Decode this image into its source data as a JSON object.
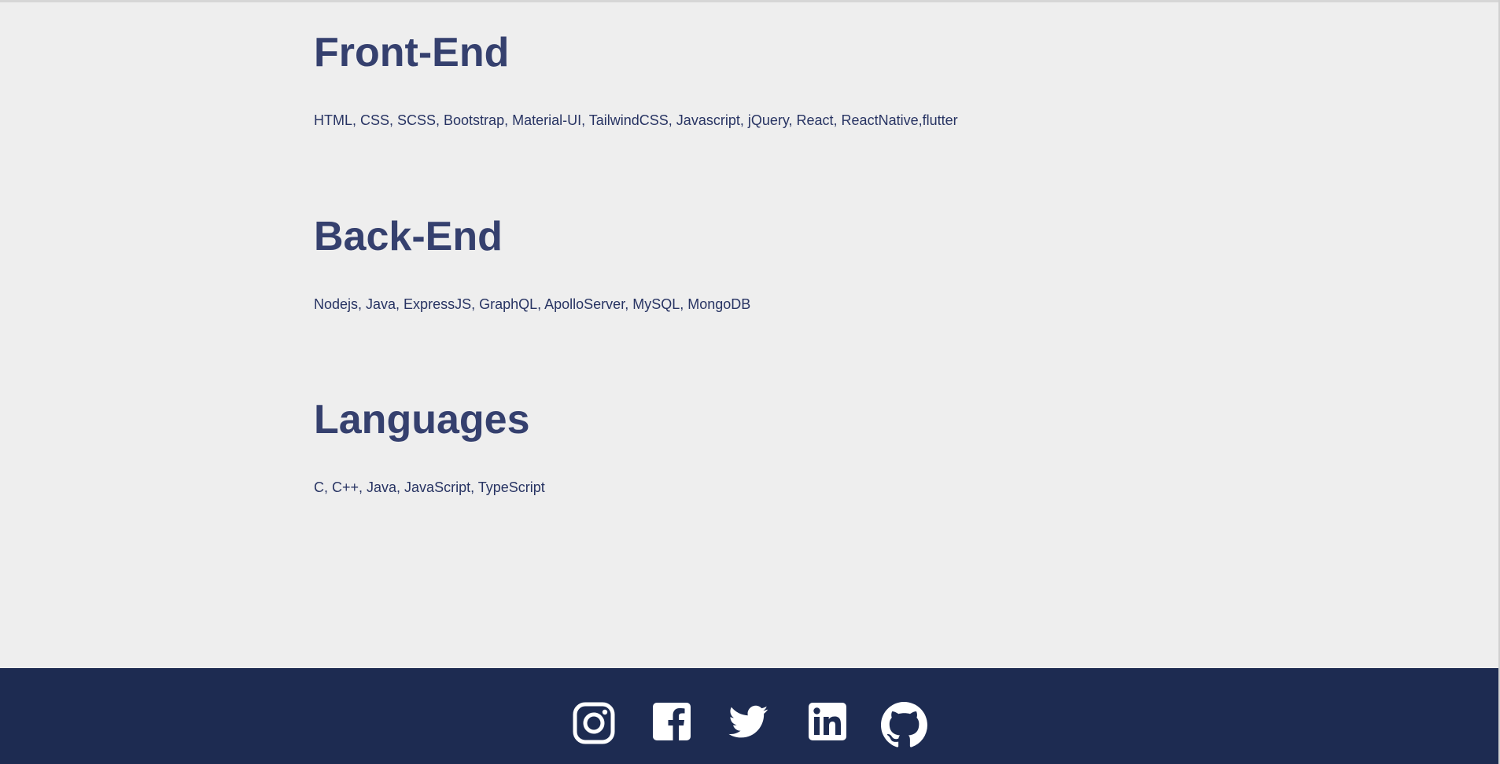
{
  "sections": [
    {
      "title": "Front-End",
      "text": "HTML, CSS, SCSS, Bootstrap, Material-UI, TailwindCSS, Javascript, jQuery, React, ReactNative,flutter"
    },
    {
      "title": "Back-End",
      "text": "Nodejs, Java, ExpressJS, GraphQL, ApolloServer, MySQL, MongoDB"
    },
    {
      "title": "Languages",
      "text": "C, C++, Java, JavaScript, TypeScript"
    }
  ],
  "footer": {
    "background": "#1d2b51",
    "icons": [
      "instagram-icon",
      "facebook-icon",
      "twitter-icon",
      "linkedin-icon",
      "github-icon"
    ]
  },
  "colors": {
    "page_background": "#eeeeee",
    "heading": "#35406e",
    "body_text": "#283463",
    "icon": "#ffffff"
  }
}
